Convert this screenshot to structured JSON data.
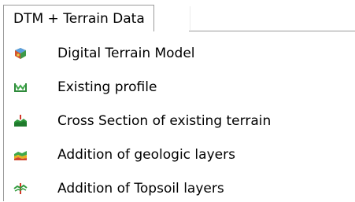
{
  "tab": {
    "label": "DTM + Terrain Data"
  },
  "menu": {
    "items": [
      {
        "label": "Digital Terrain Model",
        "icon": "terrain-cube-icon"
      },
      {
        "label": "Existing profile",
        "icon": "profile-icon"
      },
      {
        "label": "Cross Section of existing terrain",
        "icon": "cross-section-icon"
      },
      {
        "label": "Addition of geologic layers",
        "icon": "geologic-layers-icon"
      },
      {
        "label": "Addition of Topsoil layers",
        "icon": "topsoil-layers-icon"
      }
    ]
  }
}
